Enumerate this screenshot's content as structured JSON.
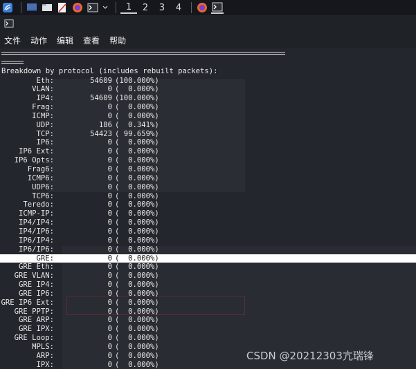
{
  "taskbar": {
    "icons": [
      "kali-menu-icon",
      "show-desktop-icon",
      "file-manager-icon",
      "text-editor-icon",
      "firefox-icon",
      "terminal-icon"
    ],
    "workspaces": [
      "1",
      "2",
      "3",
      "4"
    ]
  },
  "menu": {
    "file": "文件",
    "action": "动作",
    "edit": "编辑",
    "view": "查看",
    "help": "帮助"
  },
  "terminal": {
    "header": "Breakdown by protocol (includes rebuilt packets):",
    "rows": [
      {
        "label": "Eth:",
        "count": "54609",
        "pct": "(100.000%)"
      },
      {
        "label": "VLAN:",
        "count": "0",
        "pct": "(  0.000%)"
      },
      {
        "label": "IP4:",
        "count": "54609",
        "pct": "(100.000%)"
      },
      {
        "label": "Frag:",
        "count": "0",
        "pct": "(  0.000%)"
      },
      {
        "label": "ICMP:",
        "count": "0",
        "pct": "(  0.000%)"
      },
      {
        "label": "UDP:",
        "count": "186",
        "pct": "(  0.341%)"
      },
      {
        "label": "TCP:",
        "count": "54423",
        "pct": "( 99.659%)"
      },
      {
        "label": "IP6:",
        "count": "0",
        "pct": "(  0.000%)"
      },
      {
        "label": "IP6 Ext:",
        "count": "0",
        "pct": "(  0.000%)"
      },
      {
        "label": "IP6 Opts:",
        "count": "0",
        "pct": "(  0.000%)"
      },
      {
        "label": "Frag6:",
        "count": "0",
        "pct": "(  0.000%)"
      },
      {
        "label": "ICMP6:",
        "count": "0",
        "pct": "(  0.000%)"
      },
      {
        "label": "UDP6:",
        "count": "0",
        "pct": "(  0.000%)"
      },
      {
        "label": "TCP6:",
        "count": "0",
        "pct": "(  0.000%)"
      },
      {
        "label": "Teredo:",
        "count": "0",
        "pct": "(  0.000%)"
      },
      {
        "label": "ICMP-IP:",
        "count": "0",
        "pct": "(  0.000%)"
      },
      {
        "label": "IP4/IP4:",
        "count": "0",
        "pct": "(  0.000%)"
      },
      {
        "label": "IP4/IP6:",
        "count": "0",
        "pct": "(  0.000%)"
      },
      {
        "label": "IP6/IP4:",
        "count": "0",
        "pct": "(  0.000%)"
      },
      {
        "label": "IP6/IP6:",
        "count": "0",
        "pct": "(  0.000%)"
      },
      {
        "label": "GRE:",
        "count": "0",
        "pct": "(  0.000%)"
      },
      {
        "label": "GRE Eth:",
        "count": "0",
        "pct": "(  0.000%)"
      },
      {
        "label": "GRE VLAN:",
        "count": "0",
        "pct": "(  0.000%)"
      },
      {
        "label": "GRE IP4:",
        "count": "0",
        "pct": "(  0.000%)"
      },
      {
        "label": "GRE IP6:",
        "count": "0",
        "pct": "(  0.000%)"
      },
      {
        "label": "GRE IP6 Ext:",
        "count": "0",
        "pct": "(  0.000%)"
      },
      {
        "label": "GRE PPTP:",
        "count": "0",
        "pct": "(  0.000%)"
      },
      {
        "label": "GRE ARP:",
        "count": "0",
        "pct": "(  0.000%)"
      },
      {
        "label": "GRE IPX:",
        "count": "0",
        "pct": "(  0.000%)"
      },
      {
        "label": "GRE Loop:",
        "count": "0",
        "pct": "(  0.000%)"
      },
      {
        "label": "MPLS:",
        "count": "0",
        "pct": "(  0.000%)"
      },
      {
        "label": "ARP:",
        "count": "0",
        "pct": "(  0.000%)"
      },
      {
        "label": "IPX:",
        "count": "0",
        "pct": "(  0.000%)"
      }
    ],
    "highlighted_row": "GRE:"
  },
  "watermark": "CSDN @20212303亢瑞锋",
  "colors": {
    "terminal_bg": "#23262c",
    "terminal_text": "#eaeaea",
    "highlight_bg": "#ffffff",
    "taskbar_bg": "#15171c",
    "kali_blue": "#3d7fd8",
    "firefox_orange": "#e8672a"
  }
}
